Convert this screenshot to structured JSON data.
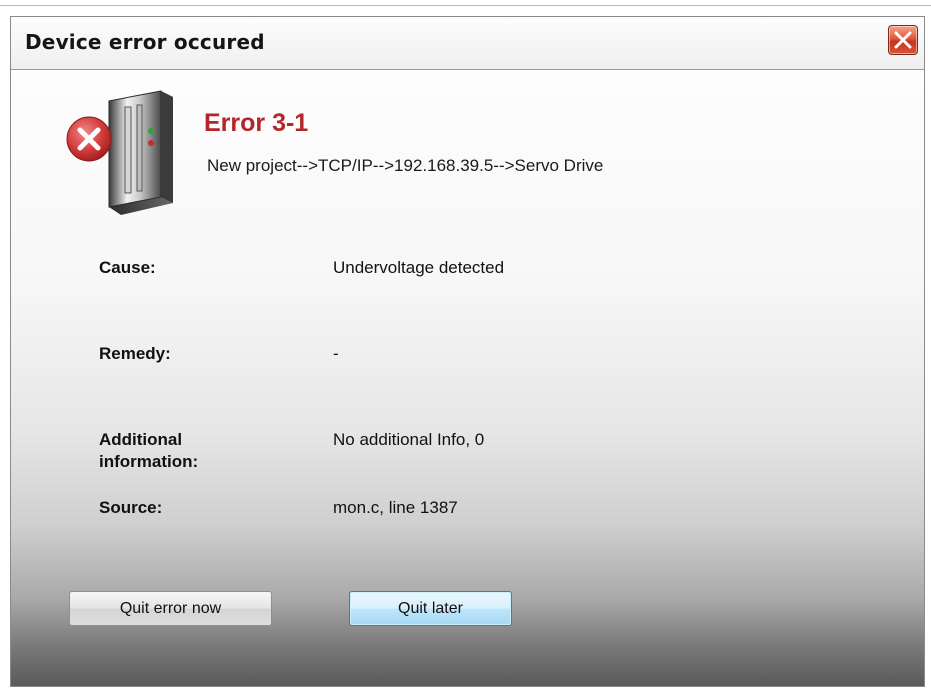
{
  "window": {
    "title": "Device error occured",
    "close_icon": "close-icon"
  },
  "error": {
    "code": "Error 3-1",
    "path": "New project-->TCP/IP-->192.168.39.5-->Servo Drive",
    "icon": "device-error-icon"
  },
  "details": {
    "cause_label": "Cause:",
    "cause_value": "Undervoltage detected",
    "remedy_label": "Remedy:",
    "remedy_value": "-",
    "additional_label": "Additional information:",
    "additional_value": "No additional Info, 0",
    "source_label": "Source:",
    "source_value": "mon.c, line 1387"
  },
  "buttons": {
    "quit_now": "Quit error now",
    "quit_later": "Quit later"
  },
  "colors": {
    "error_title": "#b3262b",
    "close_button": "#d8543a",
    "focused_button_border": "#3c7fb1"
  }
}
